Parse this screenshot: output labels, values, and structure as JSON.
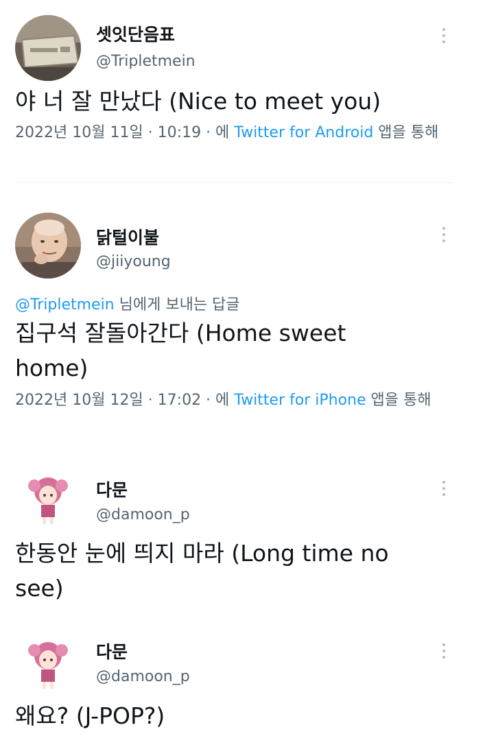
{
  "tweets": [
    {
      "name": "셋잇단음표",
      "handle": "@Tripletmein",
      "avatar_icon": "photo-avatar",
      "text": "야 너 잘 만났다 (Nice to meet you)",
      "meta_prefix": "2022년 10월 11일 · 10:19 · 에 ",
      "source": "Twitter for Android",
      "meta_suffix": " 앱을 통해"
    },
    {
      "name": "닭털이불",
      "handle": "@jiiyoung",
      "avatar_icon": "bald-man-avatar",
      "reply_mention": "@Tripletmein",
      "reply_suffix": " 님에게 보내는 답글",
      "text": "집구석 잘돌아간다 (Home sweet home)",
      "meta_prefix": "2022년 10월 12일 · 17:02 · 에 ",
      "source": "Twitter for iPhone",
      "meta_suffix": " 앱을 통해"
    },
    {
      "name": "다문",
      "handle": "@damoon_p",
      "avatar_icon": "anime-girl-avatar",
      "text": "한동안 눈에 띄지 마라 (Long time no see)"
    },
    {
      "name": "다문",
      "handle": "@damoon_p",
      "avatar_icon": "anime-girl-avatar",
      "text": "왜요? (J-POP?)"
    }
  ],
  "colors": {
    "link": "#1d9bf0",
    "secondary_text": "#536471",
    "primary_text": "#0f1419"
  }
}
